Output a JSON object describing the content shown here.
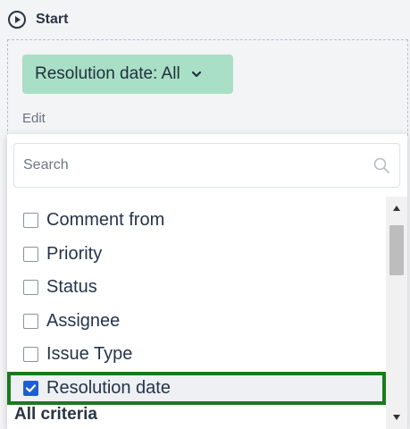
{
  "start": {
    "label": "Start",
    "icon": "play-circle-icon"
  },
  "chip": {
    "label": "Resolution date: All",
    "icon": "chevron-down-icon"
  },
  "edit_label": "Edit",
  "search": {
    "placeholder": "Search",
    "icon": "search-icon"
  },
  "options": [
    {
      "label": "Comment from",
      "checked": false
    },
    {
      "label": "Priority",
      "checked": false
    },
    {
      "label": "Status",
      "checked": false
    },
    {
      "label": "Assignee",
      "checked": false
    },
    {
      "label": "Issue Type",
      "checked": false
    },
    {
      "label": "Resolution date",
      "checked": true
    }
  ],
  "all_criteria_label": "All criteria",
  "colors": {
    "chip_bg": "#a9dfc6",
    "checkbox_checked": "#1d5fd1",
    "highlight_border": "#1a7a1f"
  }
}
